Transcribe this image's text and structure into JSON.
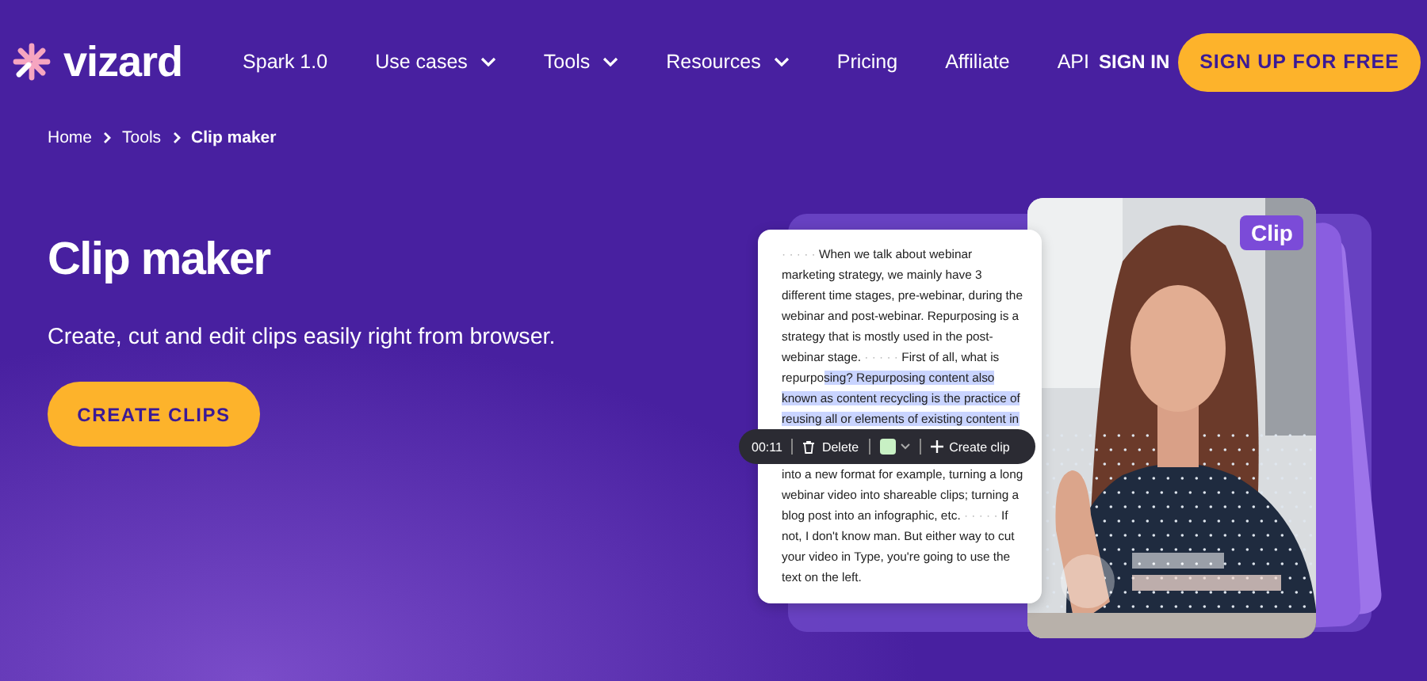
{
  "nav": {
    "logo": "vizard",
    "items": [
      {
        "label": "Spark 1.0",
        "dropdown": false
      },
      {
        "label": "Use cases",
        "dropdown": true
      },
      {
        "label": "Tools",
        "dropdown": true
      },
      {
        "label": "Resources",
        "dropdown": true
      },
      {
        "label": "Pricing",
        "dropdown": false
      },
      {
        "label": "Affiliate",
        "dropdown": false
      },
      {
        "label": "API",
        "dropdown": false
      }
    ],
    "sign_in": "SIGN IN",
    "signup": "SIGN UP FOR FREE"
  },
  "breadcrumb": [
    {
      "label": "Home",
      "current": false
    },
    {
      "label": "Tools",
      "current": false
    },
    {
      "label": "Clip maker",
      "current": true
    }
  ],
  "hero": {
    "title": "Clip maker",
    "subtitle": "Create, cut and edit clips easily right from browser.",
    "cta": "CREATE CLIPS"
  },
  "transcript": {
    "lines": [
      [
        {
          "kind": "pause",
          "text": "· · · · ·"
        },
        {
          "kind": "plain",
          "text": " When we talk about webinar"
        }
      ],
      [
        {
          "kind": "plain",
          "text": "marketing strategy, we mainly have 3"
        }
      ],
      [
        {
          "kind": "plain",
          "text": "different time stages, pre-webinar, during the"
        }
      ],
      [
        {
          "kind": "plain",
          "text": "webinar and post-webinar. Repurposing is a"
        }
      ],
      [
        {
          "kind": "plain",
          "text": "strategy that is mostly used in the post-"
        }
      ],
      [
        {
          "kind": "plain",
          "text": "webinar stage. "
        },
        {
          "kind": "pause",
          "text": "· · · · ·"
        },
        {
          "kind": "plain",
          "text": " First of all, what is"
        }
      ],
      [
        {
          "kind": "plain",
          "text": "repurpo"
        },
        {
          "kind": "highlight",
          "text": "sing? Repurposing content also"
        }
      ],
      [
        {
          "kind": "highlight",
          "text": "known as content recycling is the practice of"
        }
      ],
      [
        {
          "kind": "highlight",
          "text": "reusing all or elements of existing content in"
        }
      ],
      [
        {
          "kind": "toolbar"
        }
      ],
      [
        {
          "kind": "plain",
          "text": "into a new format for example, turning a long"
        }
      ],
      [
        {
          "kind": "plain",
          "text": "webinar video into shareable clips; turning a"
        }
      ],
      [
        {
          "kind": "plain",
          "text": "blog post into an infographic, etc. "
        },
        {
          "kind": "pause",
          "text": "· · · · ·"
        },
        {
          "kind": "plain",
          "text": " If"
        }
      ],
      [
        {
          "kind": "plain",
          "text": "not, I don't know man. But either way to cut"
        }
      ],
      [
        {
          "kind": "plain",
          "text": "your video in Type, you're going to use the"
        }
      ],
      [
        {
          "kind": "plain",
          "text": "text on the left."
        }
      ]
    ],
    "toolbar": {
      "time": "00:11",
      "delete": "Delete",
      "create": "Create clip"
    }
  },
  "photo": {
    "kind": "picture",
    "badge": "Clip"
  }
}
